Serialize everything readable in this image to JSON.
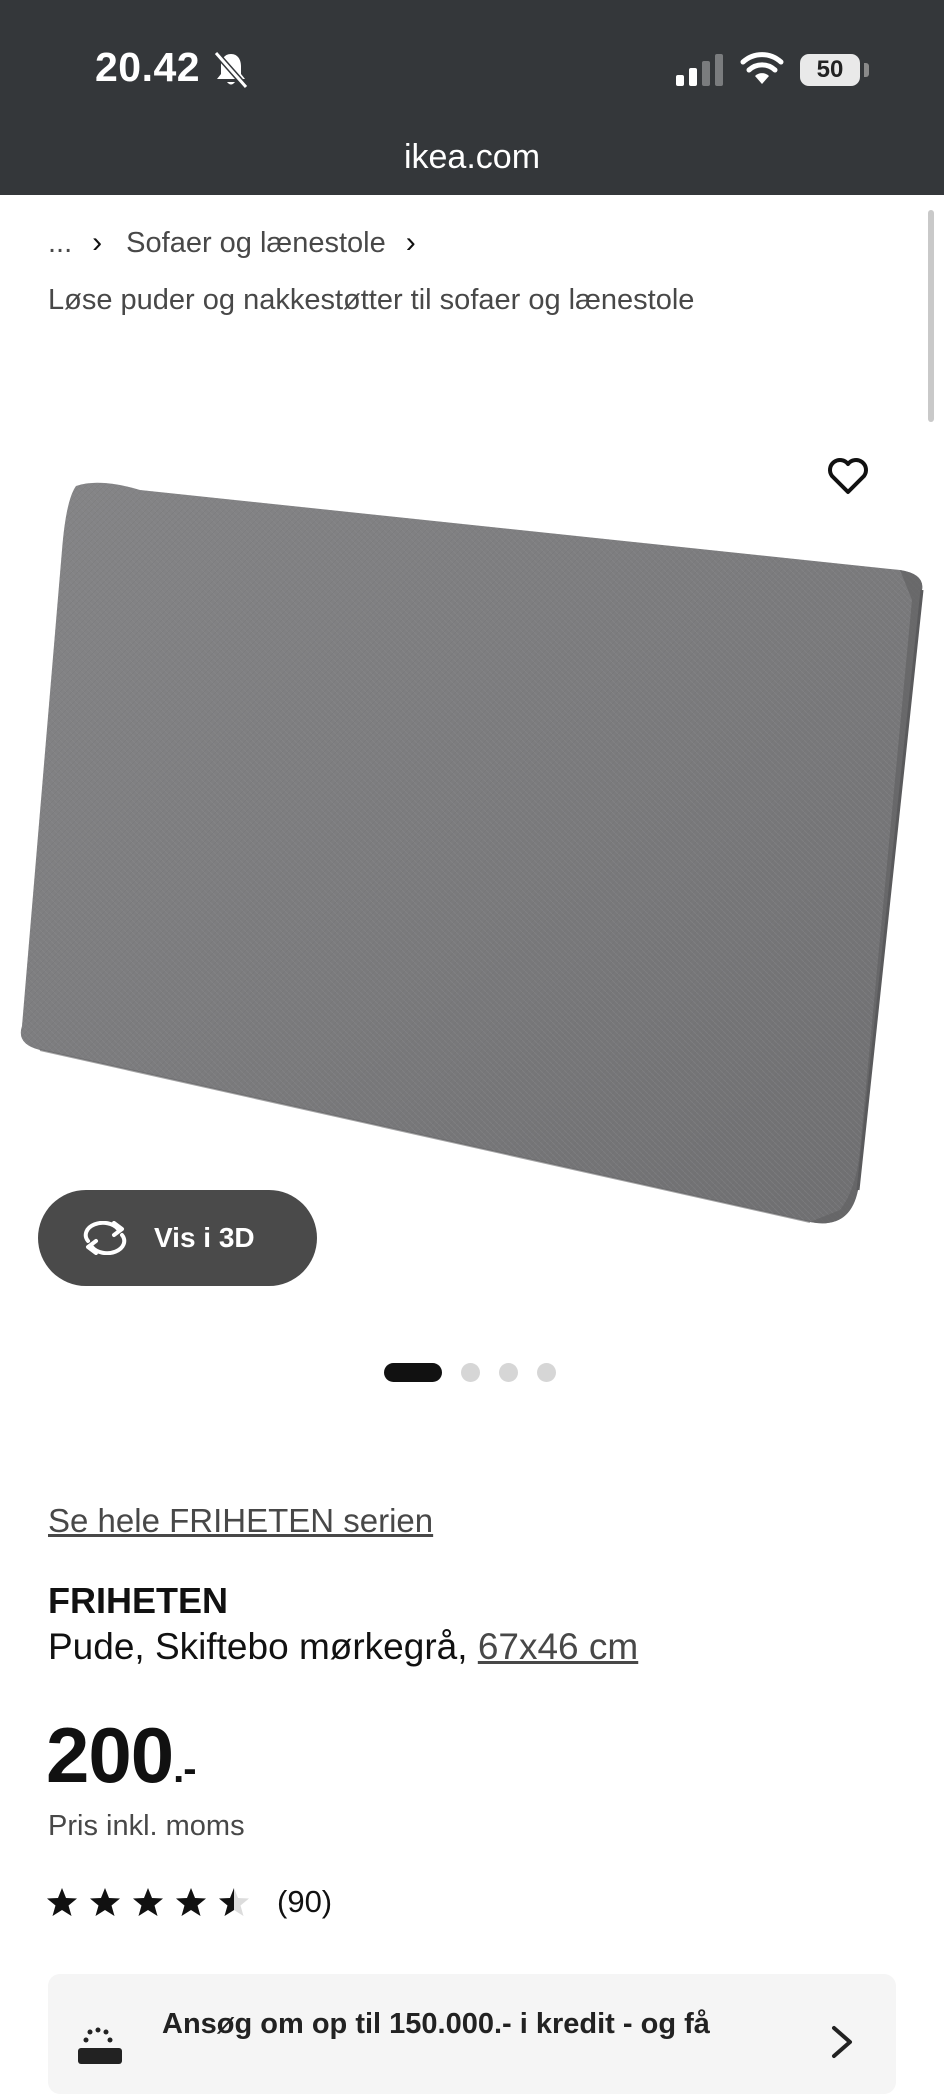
{
  "status_bar": {
    "time": "20.42",
    "battery": "50"
  },
  "browser": {
    "url": "ikea.com"
  },
  "breadcrumb": {
    "ellipsis": "...",
    "separator": "›",
    "category": "Sofaer og lænestole"
  },
  "subcategory": "Løse puder og nakkestøtter til sofaer og lænestole",
  "product": {
    "view_3d_label": "Vis i 3D",
    "image_count": 4,
    "active_image": 1,
    "series_link": "Se hele FRIHETEN serien",
    "name": "FRIHETEN",
    "description": "Pude, Skiftebo mørkegrå,",
    "size": "67x46 cm",
    "price": "200",
    "price_suffix": ".-",
    "price_note": "Pris inkl. moms",
    "rating": 4.5,
    "rating_max": 5,
    "review_count": "(90)"
  },
  "credit_banner": {
    "text": "Ansøg om op til 150.000.- i kredit - og få"
  },
  "colors": {
    "status_bar_bg": "#34373a",
    "button_3d_bg": "#4a4a4a",
    "text_primary": "#111111",
    "text_secondary": "#484848",
    "cushion_fill": "#7c7c7e"
  }
}
